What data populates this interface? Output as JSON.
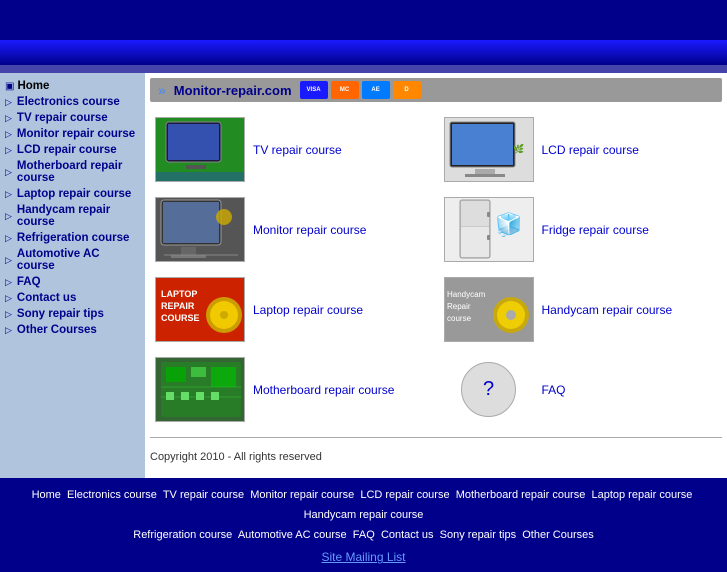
{
  "header": {
    "site_name": "Monitor-repair.com"
  },
  "sidebar": {
    "home_label": "Home",
    "items": [
      {
        "label": "Electronics course",
        "href": "#"
      },
      {
        "label": "TV repair course",
        "href": "#"
      },
      {
        "label": "Monitor repair course",
        "href": "#"
      },
      {
        "label": "LCD repair course",
        "href": "#"
      },
      {
        "label": "Motherboard repair course",
        "href": "#"
      },
      {
        "label": "Laptop repair course",
        "href": "#"
      },
      {
        "label": "Handycam repair course",
        "href": "#"
      },
      {
        "label": "Refrigeration course",
        "href": "#"
      },
      {
        "label": "Automotive AC course",
        "href": "#"
      },
      {
        "label": "FAQ",
        "href": "#"
      },
      {
        "label": "Contact us",
        "href": "#"
      },
      {
        "label": "Sony repair tips",
        "href": "#"
      },
      {
        "label": "Other Courses",
        "href": "#"
      }
    ]
  },
  "courses": [
    {
      "id": "tv",
      "title": "TV repair course",
      "thumb_type": "tv"
    },
    {
      "id": "lcd",
      "title": "LCD repair course",
      "thumb_type": "lcd"
    },
    {
      "id": "monitor",
      "title": "Monitor repair course",
      "thumb_type": "monitor"
    },
    {
      "id": "fridge",
      "title": "Fridge repair course",
      "thumb_type": "fridge"
    },
    {
      "id": "laptop",
      "title": "Laptop repair course",
      "thumb_type": "laptop"
    },
    {
      "id": "handycam",
      "title": "Handycam repair course",
      "thumb_type": "handycam"
    },
    {
      "id": "motherboard",
      "title": "Motherboard repair course",
      "thumb_type": "motherboard"
    },
    {
      "id": "faq",
      "title": "FAQ",
      "thumb_type": "faq"
    }
  ],
  "copyright": "Copyright 2010 - All rights reserved",
  "footer": {
    "links": [
      "Home",
      "Electronics course",
      "TV repair course",
      "Monitor repair course",
      "LCD repair course",
      "Motherboard repair course",
      "Laptop repair course",
      "Handycam repair course",
      "Refrigeration course",
      "Automotive AC course",
      "FAQ",
      "Contact us",
      "Sony repair tips",
      "Other Courses"
    ],
    "mailing_label": "Site Mailing List"
  }
}
